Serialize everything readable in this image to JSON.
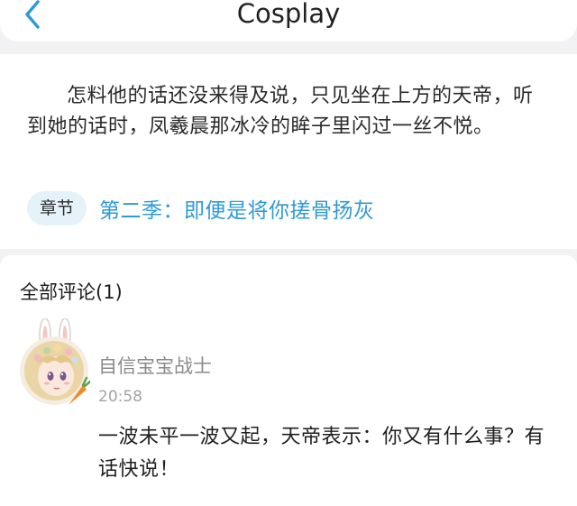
{
  "header": {
    "title": "Cosplay",
    "back_icon": "chevron-left-icon",
    "accent_color": "#2f9ad6"
  },
  "content": {
    "excerpt": "怎料他的话还没来得及说，只见坐在上方的天帝，听到她的话时，凤羲晨那冰冷的眸子里闪过一丝不悦。",
    "chapter_tag": "章节",
    "chapter_title": "第二季：即便是将你搓骨扬灰"
  },
  "comments": {
    "heading": "全部评论(1)",
    "items": [
      {
        "avatar": "anime-girl-bunny-ears-avatar",
        "username": "自信宝宝战士",
        "time": "20:58",
        "text": "一波未平一波又起，天帝表示：你又有什么事？有话快说！"
      }
    ]
  }
}
